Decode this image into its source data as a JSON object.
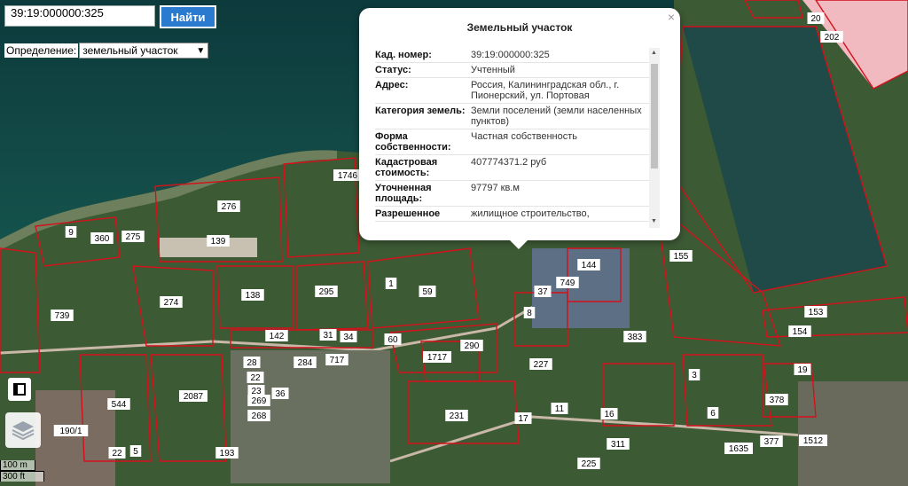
{
  "search": {
    "value": "39:19:000000:325",
    "button_label": "Найти"
  },
  "definition": {
    "label": "Определение:",
    "selected": "земельный участок"
  },
  "popup": {
    "title": "Земельный участок",
    "close": "×",
    "rows": [
      {
        "key": "Кад. номер:",
        "value": "39:19:000000:325"
      },
      {
        "key": "Статус:",
        "value": "Учтенный"
      },
      {
        "key": "Адрес:",
        "value": "Россия, Калининградская обл., г. Пионерский, ул. Портовая"
      },
      {
        "key": "Категория земель:",
        "value": "Земли поселений (земли населенных пунктов)"
      },
      {
        "key": "Форма собственности:",
        "value": "Частная собственность"
      },
      {
        "key": "Кадастровая стоимость:",
        "value": "407774371.2 руб"
      },
      {
        "key": "Уточненная площадь:",
        "value": "97797 кв.м"
      },
      {
        "key": "Разрешенное",
        "value": "жилищное строительство,"
      }
    ]
  },
  "scale": {
    "metric": "100 m",
    "imperial": "300 ft"
  },
  "parcel_labels": [
    "1746",
    "276",
    "139",
    "9",
    "360",
    "275",
    "739",
    "274",
    "138",
    "295",
    "1",
    "59",
    "142",
    "31",
    "34",
    "60",
    "290",
    "1717",
    "284",
    "717",
    "28",
    "22",
    "23",
    "36",
    "2087",
    "544",
    "190/1",
    "22",
    "5",
    "193",
    "269",
    "268",
    "231",
    "17",
    "11",
    "16",
    "311",
    "1635",
    "377",
    "155",
    "153",
    "154",
    "383",
    "37",
    "144",
    "749",
    "8",
    "227",
    "19",
    "378",
    "3",
    "6",
    "202",
    "20",
    "1512",
    "225"
  ],
  "colors": {
    "parcel_border": "#d4111b",
    "parcel_label_fill": "#ffffff",
    "button": "#2a7ad0",
    "sea": "#0f3b38"
  }
}
